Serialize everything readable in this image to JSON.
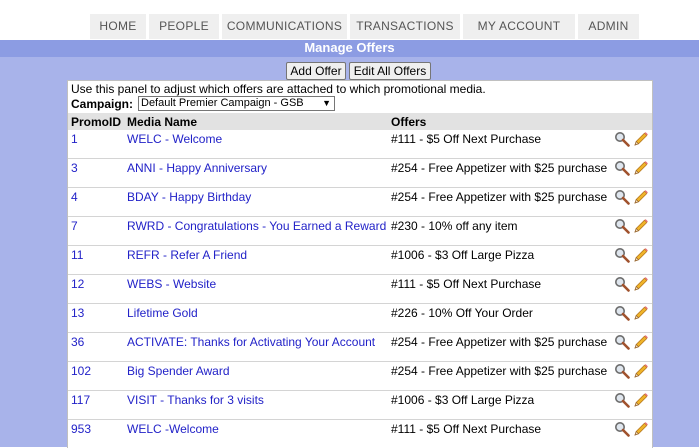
{
  "nav": {
    "tabs": [
      "HOME",
      "PEOPLE",
      "COMMUNICATIONS",
      "TRANSACTIONS",
      "MY ACCOUNT",
      "ADMIN"
    ]
  },
  "page": {
    "title": "Manage Offers",
    "add_offer_label": "Add Offer",
    "edit_all_label": "Edit All Offers",
    "intro_text": "Use this panel to adjust which offers are attached to which promotional media.",
    "campaign_label": "Campaign:",
    "campaign_selected": "Default Premier Campaign - GSB"
  },
  "table": {
    "headers": [
      "PromoID",
      "Media Name",
      "Offers"
    ],
    "rows": [
      {
        "id": "1",
        "media": "WELC - Welcome",
        "offer": "#111 - $5 Off Next Purchase"
      },
      {
        "id": "3",
        "media": "ANNI - Happy Anniversary",
        "offer": "#254 - Free Appetizer with $25 purchase"
      },
      {
        "id": "4",
        "media": "BDAY - Happy Birthday",
        "offer": "#254 - Free Appetizer with $25 purchase"
      },
      {
        "id": "7",
        "media": "RWRD - Congratulations - You Earned a Reward",
        "offer": "#230 - 10% off any item"
      },
      {
        "id": "11",
        "media": "REFR - Refer A Friend",
        "offer": "#1006 - $3 Off Large Pizza"
      },
      {
        "id": "12",
        "media": "WEBS - Website",
        "offer": "#111 - $5 Off Next Purchase"
      },
      {
        "id": "13",
        "media": "Lifetime Gold",
        "offer": "#226 - 10% Off Your Order"
      },
      {
        "id": "36",
        "media": "ACTIVATE: Thanks for Activating Your Account",
        "offer": "#254 - Free Appetizer with $25 purchase"
      },
      {
        "id": "102",
        "media": "Big Spender Award",
        "offer": "#254 - Free Appetizer with $25 purchase"
      },
      {
        "id": "117",
        "media": "VISIT - Thanks for 3 visits",
        "offer": "#1006 - $3 Off Large Pizza"
      },
      {
        "id": "953",
        "media": "WELC -Welcome",
        "offer": "#111 - $5 Off Next Purchase"
      }
    ]
  },
  "colors": {
    "header_band": "#8c9ce3",
    "background": "#a8b3ea",
    "link": "#2222c8"
  },
  "icons": {
    "view": "magnifier-icon",
    "edit": "pencil-icon"
  }
}
